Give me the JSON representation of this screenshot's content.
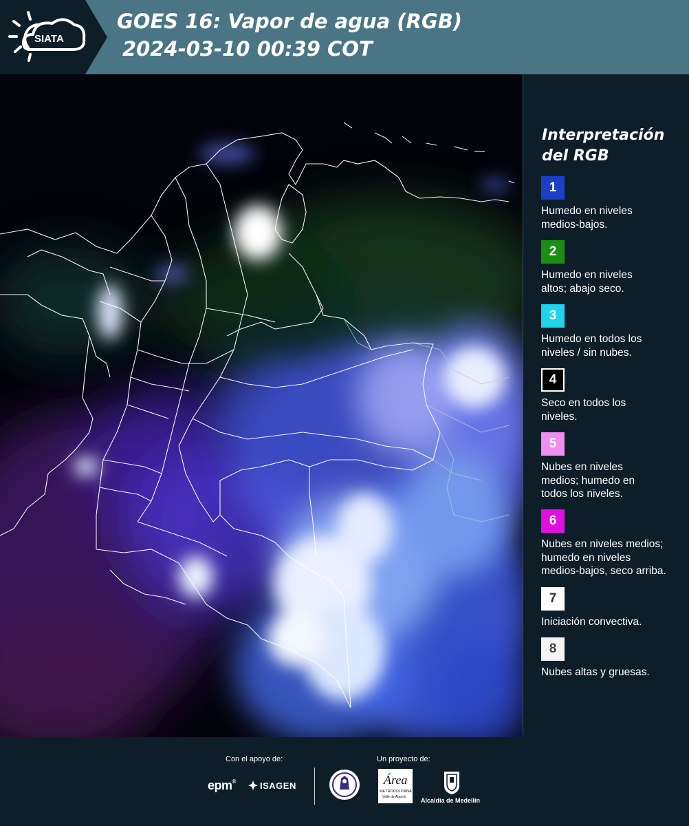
{
  "header": {
    "logo_text": "SIATA",
    "title": "GOES 16: Vapor de agua (RGB)",
    "datetime": "2024-03-10 00:39 COT"
  },
  "legend": {
    "title_line1": "Interpretación",
    "title_line2": "del RGB",
    "items": [
      {
        "number": "1",
        "color": "#1a3fc4",
        "number_color": "#ffffff",
        "line1": "Humedo en niveles",
        "line2": "medios-bajos.",
        "line3": ""
      },
      {
        "number": "2",
        "color": "#1a8f12",
        "number_color": "#ffffff",
        "line1": "Humedo en niveles",
        "line2": "altos; abajo seco.",
        "line3": ""
      },
      {
        "number": "3",
        "color": "#20d2ec",
        "number_color": "#ffffff",
        "line1": "Humedo en todos los",
        "line2": "niveles / sin nubes.",
        "line3": ""
      },
      {
        "number": "4",
        "color": "#000000",
        "number_color": "#ffffff",
        "line1": "Seco en todos los",
        "line2": "niveles.",
        "line3": ""
      },
      {
        "number": "5",
        "color": "#f08ef0",
        "number_color": "#ffffff",
        "line1": "Nubes en niveles",
        "line2": "medios; humedo en",
        "line3": "todos los niveles."
      },
      {
        "number": "6",
        "color": "#e010e0",
        "number_color": "#ffffff",
        "line1": "Nubes en niveles medios;",
        "line2": "humedo en niveles",
        "line3": "medios-bajos, seco arriba."
      },
      {
        "number": "7",
        "color": "#ffffff",
        "number_color": "#333333",
        "line1": "Iniciación convectiva.",
        "line2": "",
        "line3": ""
      },
      {
        "number": "8",
        "color": "#f4f4f4",
        "number_color": "#444444",
        "line1": "Nubes altas y gruesas.",
        "line2": "",
        "line3": ""
      }
    ]
  },
  "footer": {
    "support_label": "Con el apoyo de:",
    "project_label": "Un proyecto de:",
    "sponsor_epm": "epm",
    "sponsor_isagen": "ISAGEN",
    "area_metro_line1": "Área",
    "area_metro_line2": "METROPOLITANA",
    "area_metro_line3": "Valle de Aburrá",
    "alcaldia": "Alcaldía de Medellín"
  }
}
